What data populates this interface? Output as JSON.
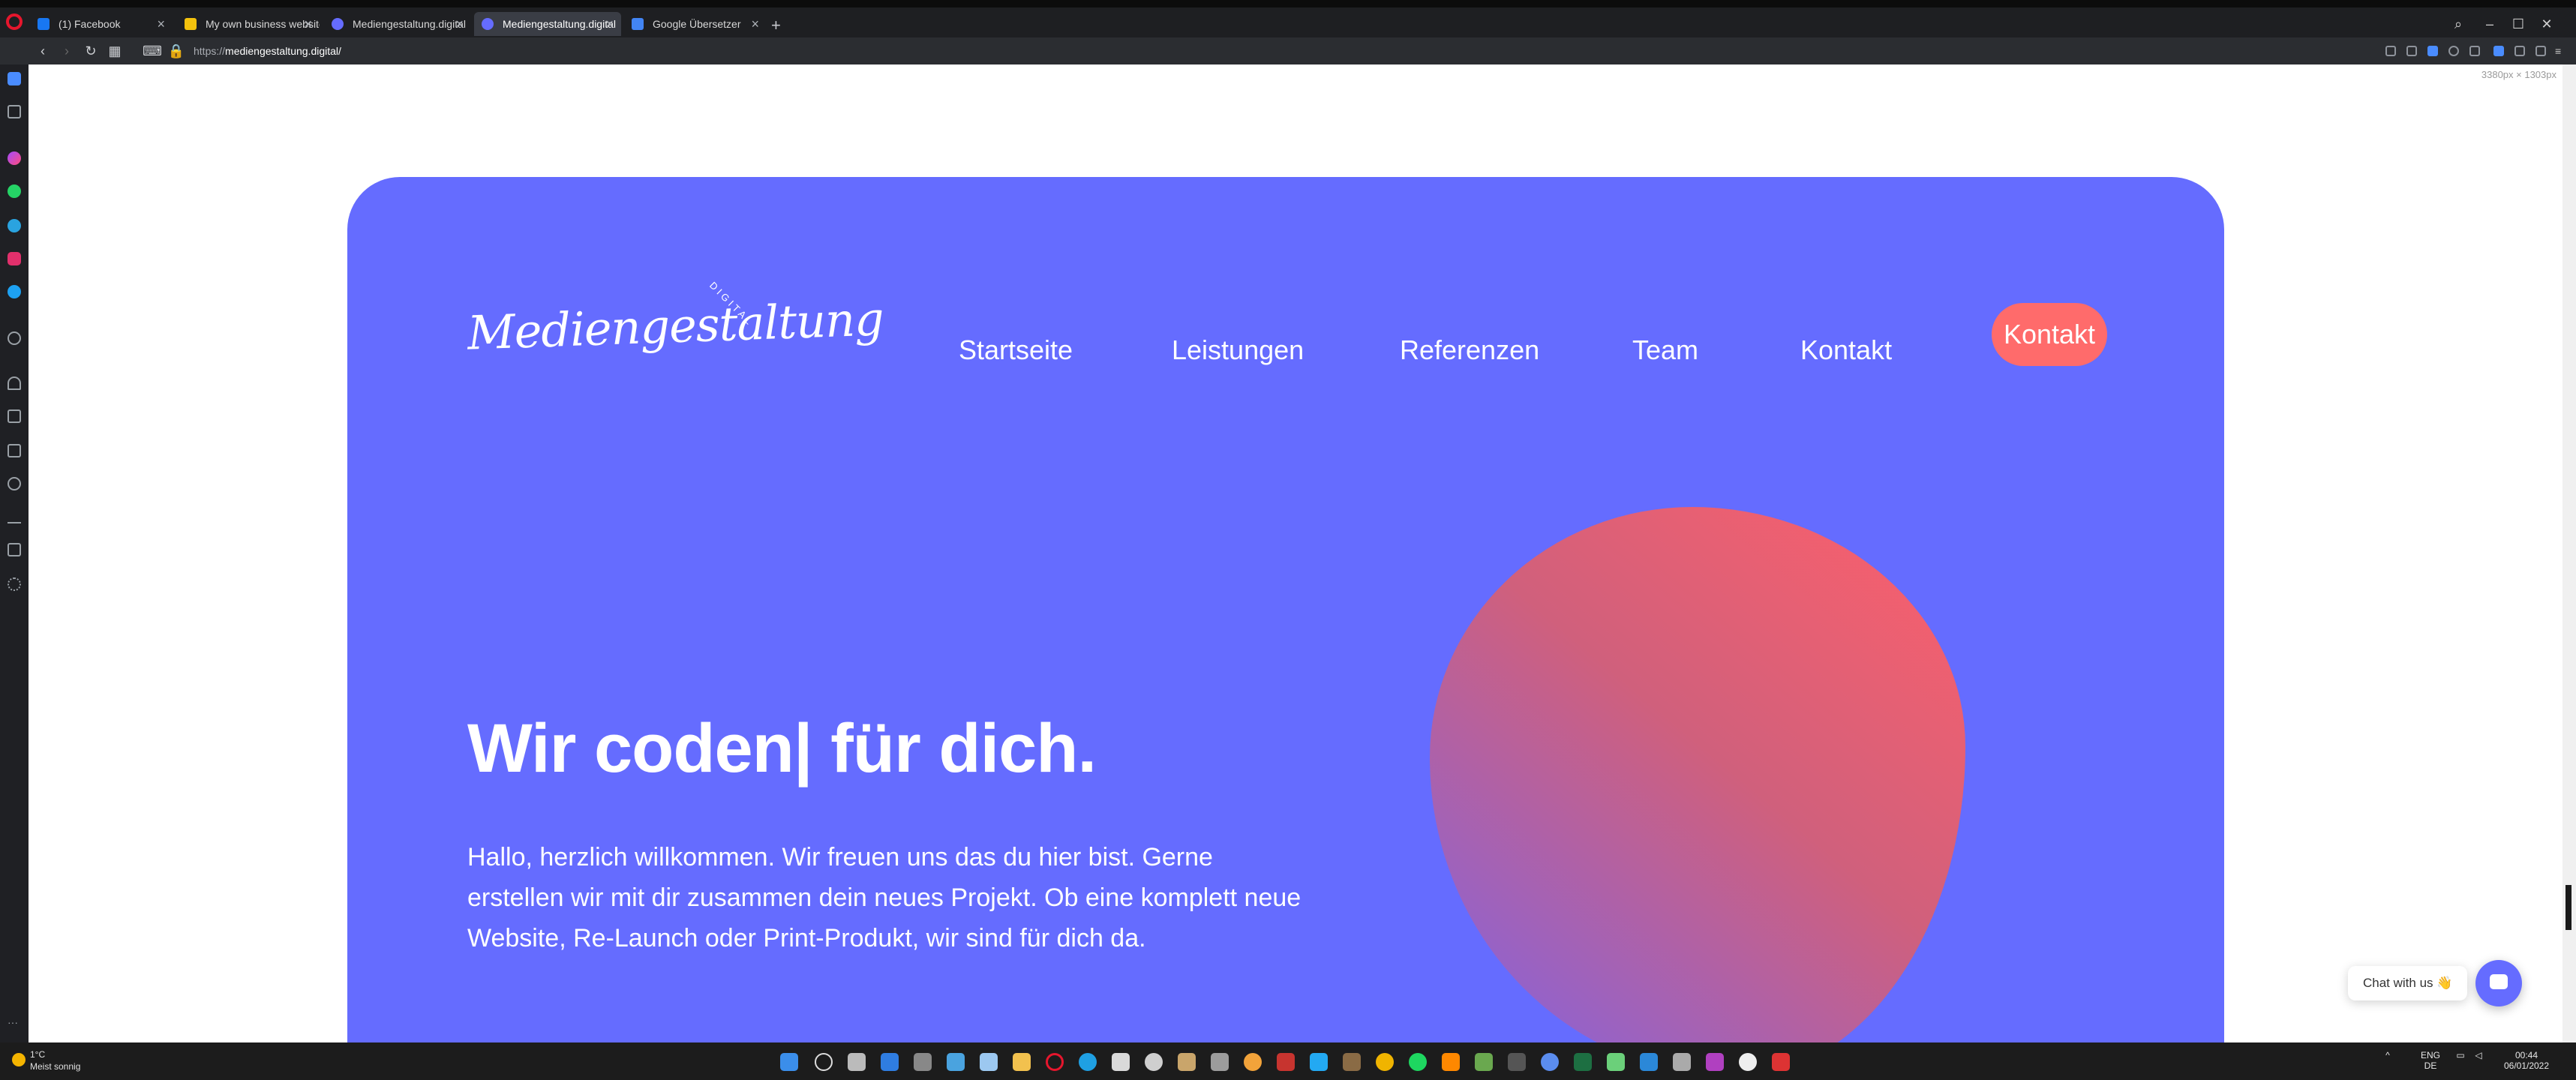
{
  "browser": {
    "tabs": [
      {
        "label": "(1) Facebook",
        "color": "#1877f2"
      },
      {
        "label": "My own business website",
        "color": "#f4c20d"
      },
      {
        "label": "Mediengestaltung.digital",
        "color": "#656cff"
      },
      {
        "label": "Mediengestaltung.digital",
        "color": "#656cff"
      },
      {
        "label": "Google Übersetzer",
        "color": "#4285f4"
      }
    ],
    "active_tab": 3,
    "url_prefix": "https://",
    "url_domain": "mediengestaltung.digital/",
    "dims_label": "3380px × 1303px"
  },
  "site": {
    "logo": "Mediengestaltung",
    "logo_sub": "DIGITAL",
    "nav": {
      "startseite": "Startseite",
      "leistungen": "Leistungen",
      "referenzen": "Referenzen",
      "team": "Team",
      "kontakt": "Kontakt",
      "cta": "Kontakt"
    },
    "headline": "Wir coden| für dich.",
    "lead": "Hallo, herzlich willkommen. Wir freuen uns das du hier bist. Gerne erstellen wir mit dir zusammen dein neues Projekt. Ob eine komplett neue Website, Re-Launch oder Print-Produkt, wir sind für dich da.",
    "chat_label": "Chat with us 👋",
    "colors": {
      "primary": "#656cff",
      "accent": "#ff6b6b"
    }
  },
  "taskbar": {
    "temp": "1°C",
    "weather": "Meist sonnig",
    "lang_top": "ENG",
    "lang_bottom": "DE",
    "time": "00:44",
    "date": "06/01/2022"
  }
}
